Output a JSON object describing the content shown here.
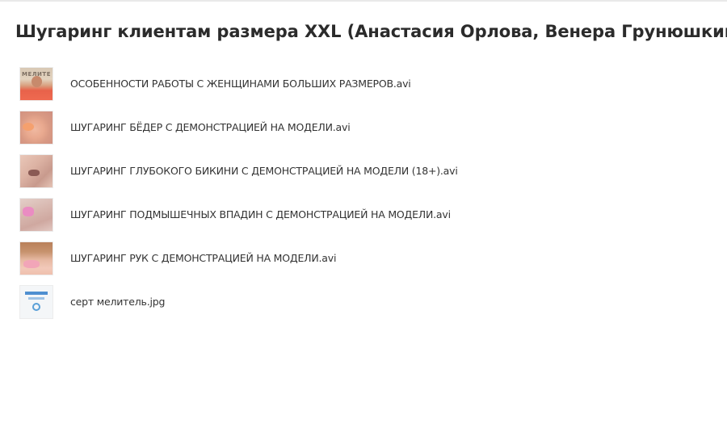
{
  "page": {
    "title": "Шугаринг клиентам размера XXL (Анастасия Орлова, Венера Грунюшкина)"
  },
  "files": [
    {
      "name": "ОСОБЕННОСТИ РАБОТЫ С ЖЕНЩИНАМИ БОЛЬШИХ РАЗМЕРОВ.avi",
      "thumb_text": "МЕЛИТЕ"
    },
    {
      "name": "ШУГАРИНГ БЁДЕР С ДЕМОНСТРАЦИЕЙ НА МОДЕЛИ.avi"
    },
    {
      "name": "ШУГАРИНГ ГЛУБОКОГО БИКИНИ С ДЕМОНСТРАЦИЕЙ НА МОДЕЛИ (18+).avi"
    },
    {
      "name": "ШУГАРИНГ ПОДМЫШЕЧНЫХ ВПАДИН С ДЕМОНСТРАЦИЕЙ НА МОДЕЛИ.avi"
    },
    {
      "name": "ШУГАРИНГ РУК С ДЕМОНСТРАЦИЕЙ НА МОДЕЛИ.avi"
    },
    {
      "name": "серт мелитель.jpg"
    }
  ]
}
